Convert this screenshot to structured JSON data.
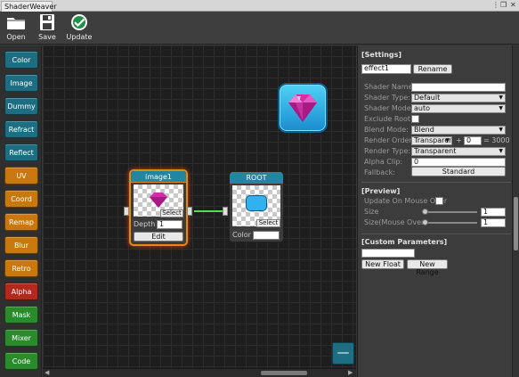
{
  "window": {
    "tab_title": "ShaderWeaver",
    "controls": [
      "⋮",
      "❐",
      "✕"
    ]
  },
  "toolbar": {
    "open": "Open",
    "save": "Save",
    "update": "Update"
  },
  "nodes_menu": [
    {
      "label": "Color",
      "color": "#1d6e82"
    },
    {
      "label": "Image",
      "color": "#1d6e82"
    },
    {
      "label": "Dummy",
      "color": "#1d6e82"
    },
    {
      "label": "Refract",
      "color": "#1d6e82"
    },
    {
      "label": "Reflect",
      "color": "#1d6e82"
    },
    {
      "label": "UV",
      "color": "#c8780c"
    },
    {
      "label": "Coord",
      "color": "#c8780c"
    },
    {
      "label": "Remap",
      "color": "#c8780c"
    },
    {
      "label": "Blur",
      "color": "#c8780c"
    },
    {
      "label": "Retro",
      "color": "#c8780c"
    },
    {
      "label": "Alpha",
      "color": "#b4281e"
    },
    {
      "label": "Mask",
      "color": "#2b8a2b"
    },
    {
      "label": "Mixer",
      "color": "#2b8a2b"
    },
    {
      "label": "Code",
      "color": "#2b8a2b"
    }
  ],
  "node_image": {
    "title": "image1",
    "select": "Select",
    "depth_label": "Depth",
    "depth_value": "1",
    "edit": "Edit"
  },
  "node_root": {
    "title": "ROOT",
    "select": "Select",
    "color_label": "Color"
  },
  "canvas": {
    "add_button": "—"
  },
  "settings": {
    "header": "[Settings]",
    "name_value": "effect1",
    "rename": "Rename",
    "shader_name_label": "Shader Name:",
    "shader_name_value": "",
    "shader_type_label": "Shader Type:",
    "shader_type_value": "Default",
    "shader_model_label": "Shader Model:",
    "shader_model_value": "auto",
    "exclude_root_label": "Exclude Root:",
    "blend_mode_label": "Blend Mode:",
    "blend_mode_value": "Blend",
    "render_order_label": "Render Order:",
    "render_order_value": "Transparen",
    "render_order_plus": "+",
    "render_order_offset": "0",
    "render_order_result": "= 3000",
    "render_type_label": "Render Type:",
    "render_type_value": "Transparent",
    "alpha_clip_label": "Alpha Clip:",
    "alpha_clip_value": "0",
    "fallback_label": "Fallback:",
    "fallback_value": "Standard"
  },
  "preview": {
    "header": "[Preview]",
    "update_on_hover_label": "Update On Mouse Over",
    "size_label": "Size",
    "size_value": "1",
    "size_hover_label": "Size(Mouse Over)",
    "size_hover_value": "1"
  },
  "custom": {
    "header": "[Custom Parameters]",
    "name_value": "",
    "new_float": "New Float",
    "new_range": "New Range"
  },
  "colors": {
    "teal_header": "#2286a0",
    "selected_glow": "#e08a1a",
    "connection": "#4be24b"
  }
}
